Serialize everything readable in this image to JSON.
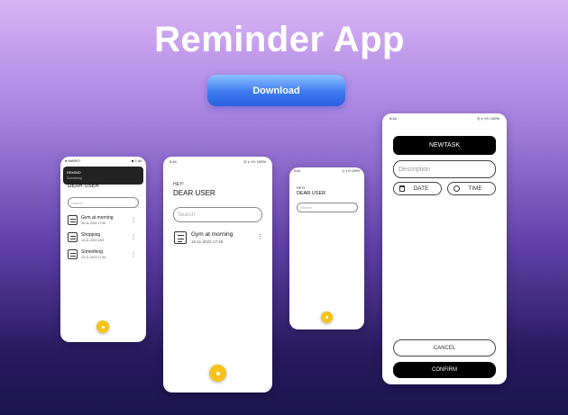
{
  "title": "Reminder App",
  "download_label": "Download",
  "colors": {
    "fab": "#f7c21a",
    "download": "#3d7bf0"
  },
  "phone1": {
    "status_left": "● MARIO",
    "status_right": "■ ≡ ull",
    "notification": {
      "title": "REMIND",
      "body": "Something"
    },
    "greeting": "DEAR USER",
    "search_placeholder": "Search",
    "tasks": [
      {
        "name": "Gym at morning",
        "date": "16-11-2022 17:45"
      },
      {
        "name": "Shopping",
        "date": "13-11-2022 18:9"
      },
      {
        "name": "Something",
        "date": "13-11-2022 17:45"
      }
    ]
  },
  "phone2": {
    "status_left": "5:44",
    "status_right": "◎ ‡ «!!ı 100%",
    "hey": "HEY!",
    "greeting": "DEAR USER",
    "search_placeholder": "Search",
    "tasks": [
      {
        "name": "Gym at morning",
        "date": "16-11-2022 17:45"
      }
    ]
  },
  "phone3": {
    "status_left": "5:44",
    "status_right": "◎ ‡ !!ı 100%",
    "hey": "HEY!",
    "greeting": "DEAR USER",
    "search_placeholder": "Search"
  },
  "phone4": {
    "status_left": "5:44",
    "status_right": "◎ ‡ «!!ı 100%",
    "header": "NEWTASK",
    "description_placeholder": "Description",
    "date_label": "DATE",
    "time_label": "TIME",
    "cancel_label": "CANCEL",
    "confirm_label": "CONFIRM"
  }
}
